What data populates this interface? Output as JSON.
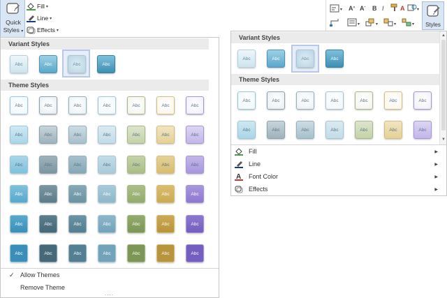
{
  "left_ribbon": {
    "quick_styles_label_line1": "Quick",
    "quick_styles_label_line2": "Styles",
    "fill_label": "Fill",
    "line_label": "Line",
    "effects_label": "Effects"
  },
  "left_gallery": {
    "variant_styles_header": "Variant Styles",
    "theme_styles_header": "Theme Styles",
    "swatch_text": "Abc",
    "allow_themes_label": "Allow Themes",
    "remove_theme_label": "Remove Theme",
    "resize_dots": "....",
    "checkmark": "✓"
  },
  "right_ribbon": {
    "styles_label": "Styles"
  },
  "right_gallery": {
    "variant_styles_header": "Variant Styles",
    "theme_styles_header": "Theme Styles",
    "menu": [
      {
        "label": "Fill",
        "icon": "fill-bucket-icon"
      },
      {
        "label": "Line",
        "icon": "line-pen-icon"
      },
      {
        "label": "Font Color",
        "icon": "font-color-icon"
      },
      {
        "label": "Effects",
        "icon": "effects-icon"
      }
    ]
  },
  "colors": {
    "accent_blue": "#4a9fc4",
    "dark_teal": "#4a7a8c",
    "green": "#9fb07a",
    "gold": "#d4b66a",
    "purple": "#8a74c8",
    "selection": "#b7c8ea"
  }
}
